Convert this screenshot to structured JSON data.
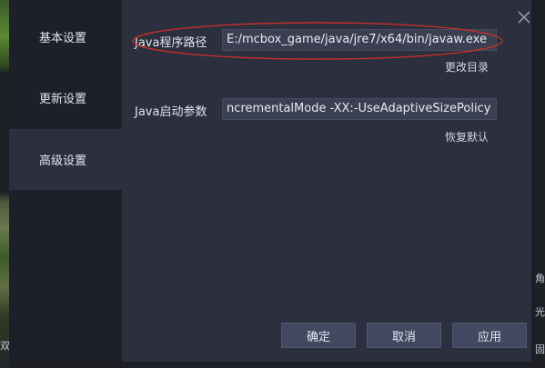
{
  "sidebar": {
    "items": [
      {
        "label": "基本设置"
      },
      {
        "label": "更新设置"
      },
      {
        "label": "高级设置"
      }
    ]
  },
  "main": {
    "java_path": {
      "label": "Java程序路径",
      "value": "E:/mcbox_game/java/jre7/x64/bin/javaw.exe"
    },
    "change_dir_link": "更改目录",
    "java_args": {
      "label": "Java启动参数",
      "value": "ncrementalMode -XX:-UseAdaptiveSizePolicy"
    },
    "restore_default_link": "恢复默认"
  },
  "buttons": {
    "confirm": "确定",
    "cancel": "取消",
    "apply": "应用"
  },
  "background_right": [
    "角",
    "光",
    "固"
  ],
  "background_left": "双",
  "colors": {
    "annotation_ellipse": "#c0302a",
    "dialog_bg": "#2c2f3e",
    "sidebar_bg": "#1d1f29"
  },
  "icons": {
    "close": "close-icon"
  }
}
